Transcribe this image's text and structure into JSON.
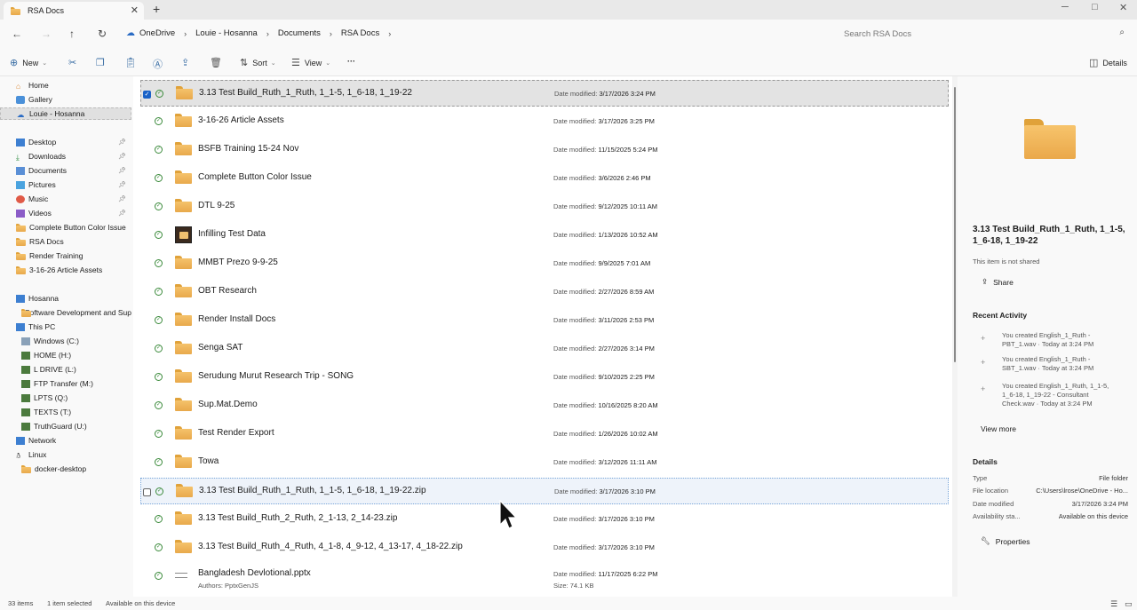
{
  "window": {
    "tab_title": "RSA Docs",
    "new_tab": "+",
    "minimize": "─",
    "maximize": "□",
    "close": "✕",
    "tab_close": "✕"
  },
  "nav": {
    "back": "←",
    "forward": "→",
    "up": "↑",
    "refresh": "↻"
  },
  "breadcrumbs": [
    "OneDrive",
    "Louie - Hosanna",
    "Documents",
    "RSA Docs"
  ],
  "search": {
    "placeholder": "Search RSA Docs"
  },
  "commands": {
    "new": "New",
    "sort": "Sort",
    "view": "View",
    "more": "···",
    "details": "Details"
  },
  "sidebar": {
    "top": [
      "Home",
      "Gallery",
      "Louie - Hosanna"
    ],
    "quick": [
      "Desktop",
      "Downloads",
      "Documents",
      "Pictures",
      "Music",
      "Videos",
      "Complete Button Color Issue",
      "RSA Docs",
      "Render Training",
      "3-16-26 Article Assets"
    ],
    "tree": [
      "Hosanna",
      "Software Development and Sup",
      "This PC",
      "Windows (C:)",
      "HOME (H:)",
      "L DRIVE (L:)",
      "FTP Transfer (M:)",
      "LPTS (Q:)",
      "TEXTS (T:)",
      "TruthGuard (U:)",
      "Network",
      "Linux",
      "docker-desktop"
    ]
  },
  "files": {
    "date_label": "Date modified:",
    "items": [
      {
        "name": "3.13 Test Build_Ruth_1_Ruth, 1_1-5, 1_6-18, 1_19-22",
        "date": "3/17/2026 3:24 PM"
      },
      {
        "name": "3-16-26 Article Assets",
        "date": "3/17/2026 3:25 PM"
      },
      {
        "name": "BSFB Training 15-24 Nov",
        "date": "11/15/2025 5:24 PM"
      },
      {
        "name": "Complete Button Color Issue",
        "date": "3/6/2026 2:46 PM"
      },
      {
        "name": "DTL 9-25",
        "date": "9/12/2025 10:11 AM"
      },
      {
        "name": "Infilling Test Data",
        "date": "1/13/2026 10:52 AM"
      },
      {
        "name": "MMBT Prezo 9-9-25",
        "date": "9/9/2025 7:01 AM"
      },
      {
        "name": "OBT Research",
        "date": "2/27/2026 8:59 AM"
      },
      {
        "name": "Render Install Docs",
        "date": "3/11/2026 2:53 PM"
      },
      {
        "name": "Senga SAT",
        "date": "2/27/2026 3:14 PM"
      },
      {
        "name": "Serudung Murut Research Trip - SONG",
        "date": "9/10/2025 2:25 PM"
      },
      {
        "name": "Sup.Mat.Demo",
        "date": "10/16/2025 8:20 AM"
      },
      {
        "name": "Test Render Export",
        "date": "1/26/2026 10:02 AM"
      },
      {
        "name": "Towa",
        "date": "3/12/2026 11:11 AM"
      },
      {
        "name": "3.13 Test Build_Ruth_1_Ruth, 1_1-5, 1_6-18, 1_19-22.zip",
        "date": "3/17/2026 3:10 PM"
      },
      {
        "name": "3.13 Test Build_Ruth_2_Ruth, 2_1-13, 2_14-23.zip",
        "date": "3/17/2026 3:10 PM"
      },
      {
        "name": "3.13 Test Build_Ruth_4_Ruth, 4_1-8, 4_9-12, 4_13-17, 4_18-22.zip",
        "date": "3/17/2026 3:10 PM"
      },
      {
        "name": "Bangladesh Devlotional.pptx",
        "date": "11/17/2025 6:22 PM",
        "authors": "Authors: PptxGenJS",
        "size": "Size: 74.1 KB"
      }
    ]
  },
  "details": {
    "title": "3.13 Test Build_Ruth_1_Ruth, 1_1-5, 1_6-18, 1_19-22",
    "shared_note": "This item is not shared",
    "share": "Share",
    "recent_heading": "Recent Activity",
    "activity": [
      "You created English_1_Ruth - PBT_1.wav · Today at 3:24 PM",
      "You created English_1_Ruth - SBT_1.wav · Today at 3:24 PM",
      "You created English_1_Ruth, 1_1-5, 1_6-18, 1_19-22 - Consultant Check.wav · Today at 3:24 PM"
    ],
    "view_more": "View more",
    "details_heading": "Details",
    "props": [
      {
        "k": "Type",
        "v": "File folder"
      },
      {
        "k": "File location",
        "v": "C:\\Users\\lrose\\OneDrive - Ho..."
      },
      {
        "k": "Date modified",
        "v": "3/17/2026 3:24 PM"
      },
      {
        "k": "Availability sta...",
        "v": "Available on this device"
      }
    ],
    "properties": "Properties"
  },
  "status": {
    "count": "33 items",
    "selected": "1 item selected",
    "availability": "Available on this device"
  }
}
